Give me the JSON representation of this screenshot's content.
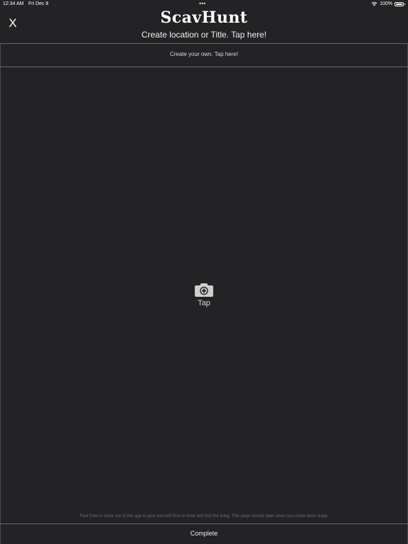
{
  "status_bar": {
    "time": "12:34 AM",
    "date": "Fri Dec 8",
    "multitask_dots": "•••",
    "battery_percent": "100%",
    "wifi_icon": "wifi-icon",
    "battery_icon": "battery-icon"
  },
  "header": {
    "close_label": "X",
    "app_title": "ScavHunt",
    "location_title": "Create location or Title. Tap here!"
  },
  "description": {
    "prompt": "Create your own. Tap here!"
  },
  "photo": {
    "icon": "camera-plus-icon",
    "tap_label": "Tap"
  },
  "footer": {
    "note": "Feel Free to close out of this app to give yourself time to think and find the thing. This page should open when you come back ready.",
    "complete_label": "Complete"
  },
  "colors": {
    "background": "#232326",
    "divider": "#6a6a6e",
    "text": "#ffffff",
    "muted_text": "#6c6c70",
    "icon": "#d0d0d0"
  }
}
